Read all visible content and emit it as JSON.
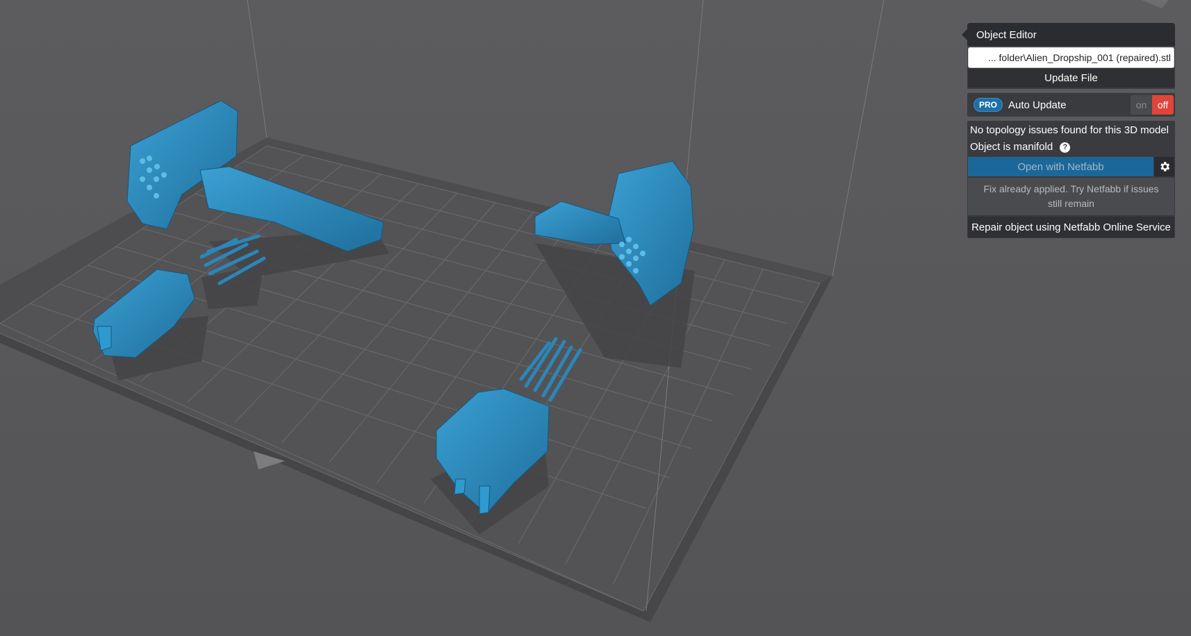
{
  "object_editor": {
    "title": "Object Editor",
    "file_path_value": "... folder\\Alien_Dropship_001 (repaired).stl",
    "update_file_label": "Update File",
    "pro_badge": "PRO",
    "auto_update_label": "Auto Update",
    "toggle_on": "on",
    "toggle_off": "off",
    "auto_update_state": "off",
    "status_message": "No topology issues found for this 3D model",
    "manifold_message": "Object is manifold",
    "help_glyph": "?",
    "open_netfabb_label": "Open with Netfabb",
    "fix_note": "Fix already applied. Try Netfabb if issues still remain",
    "repair_label": "Repair object using Netfabb Online Service"
  },
  "colors": {
    "background": "#5b5b5d",
    "model": "#2b86b9",
    "accent_off": "#e0453a",
    "netfabb_button": "#1c6799"
  },
  "icons": [
    "gear-icon",
    "help-icon",
    "dropdown-arrow-icon"
  ]
}
